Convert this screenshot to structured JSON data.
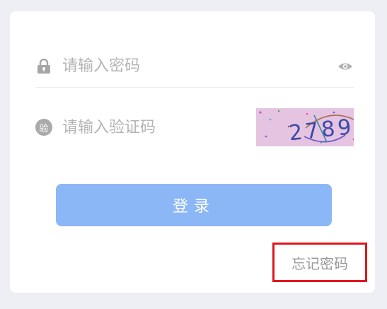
{
  "password": {
    "placeholder": "请输入密码",
    "lock_icon": "lock-icon",
    "eye_icon": "eye-icon"
  },
  "captcha": {
    "badge": "验",
    "placeholder": "请输入验证码",
    "image_text": "2789"
  },
  "login_button": "登录",
  "forgot_password": "忘记密码",
  "colors": {
    "primary_button": "#8cb7f7",
    "highlight_box": "#e0161d",
    "captcha_bg": "#e5c4e2"
  }
}
